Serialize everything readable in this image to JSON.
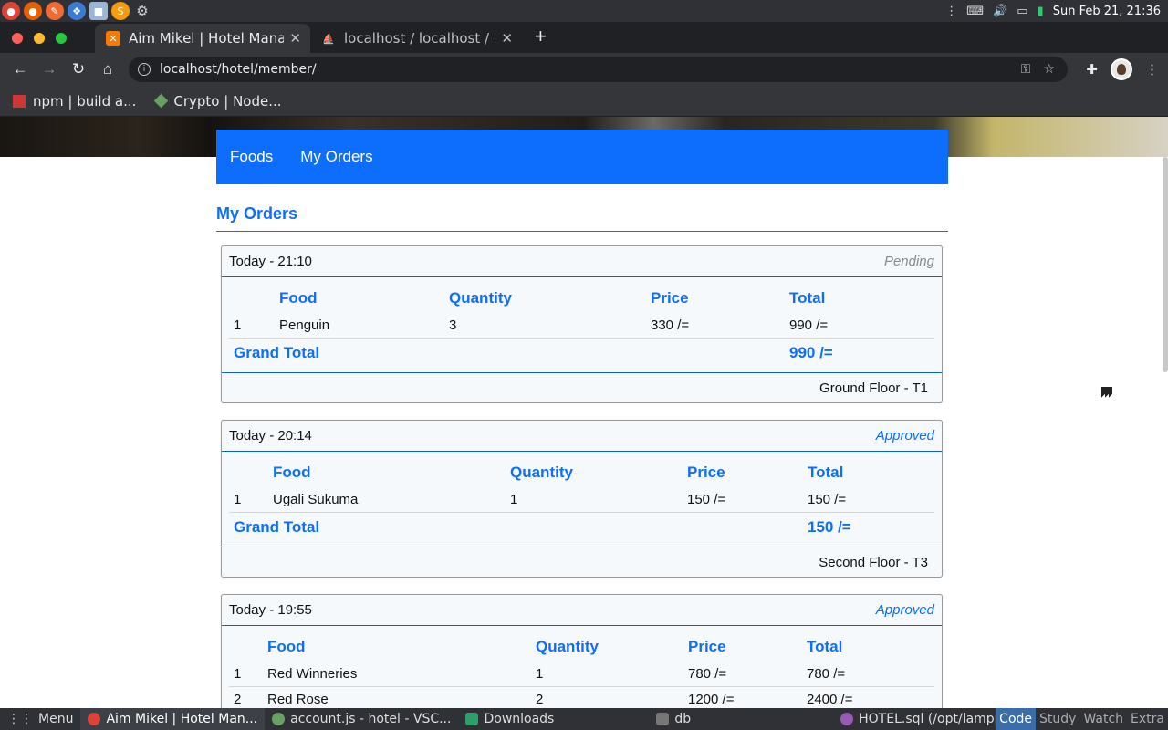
{
  "os": {
    "clock": "Sun Feb 21, 21:36"
  },
  "browser": {
    "tabs": [
      {
        "title": "Aim Mikel | Hotel Management",
        "active": true
      },
      {
        "title": "localhost / localhost / HOTEL",
        "active": false
      }
    ],
    "url": "localhost/hotel/member/",
    "bookmarks": [
      {
        "label": "npm | build a..."
      },
      {
        "label": "Crypto | Node..."
      }
    ]
  },
  "site": {
    "nav": [
      "Foods",
      "My Orders"
    ],
    "heading": "My Orders",
    "columns": {
      "food": "Food",
      "quantity": "Quantity",
      "price": "Price",
      "total": "Total"
    },
    "grand_total_label": "Grand Total"
  },
  "orders": [
    {
      "time": "Today - 21:10",
      "status": "Pending",
      "items": [
        {
          "no": "1",
          "food": "Penguin",
          "quantity": "3",
          "price": "330 /=",
          "total": "990 /="
        }
      ],
      "grand_total": "990 /=",
      "location": "Ground Floor - T1"
    },
    {
      "time": "Today - 20:14",
      "status": "Approved",
      "items": [
        {
          "no": "1",
          "food": "Ugali Sukuma",
          "quantity": "1",
          "price": "150 /=",
          "total": "150 /="
        }
      ],
      "grand_total": "150 /=",
      "location": "Second Floor - T3"
    },
    {
      "time": "Today - 19:55",
      "status": "Approved",
      "items": [
        {
          "no": "1",
          "food": "Red Winneries",
          "quantity": "1",
          "price": "780 /=",
          "total": "780 /="
        },
        {
          "no": "2",
          "food": "Red Rose",
          "quantity": "2",
          "price": "1200 /=",
          "total": "2400 /="
        }
      ],
      "grand_total": "",
      "location": ""
    }
  ],
  "taskbar": {
    "menu": "Menu",
    "tasks": [
      {
        "label": "Aim Mikel | Hotel Man...",
        "active": true
      },
      {
        "label": "account.js - hotel - VSC...",
        "active": false
      },
      {
        "label": "Downloads",
        "active": false
      },
      {
        "label": "db",
        "active": false
      },
      {
        "label": "HOTEL.sql (/opt/lampp...",
        "active": false
      }
    ],
    "workspaces": [
      "Code",
      "Study",
      "Watch",
      "Extra"
    ]
  }
}
